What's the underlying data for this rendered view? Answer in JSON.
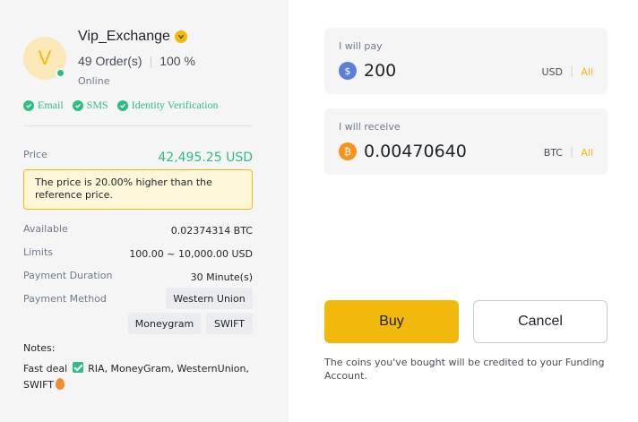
{
  "merchant": {
    "avatar_letter": "V",
    "name": "Vip_Exchange",
    "orders": "49 Order(s)",
    "completion": "100 %",
    "status": "Online",
    "verifications": [
      "Email",
      "SMS",
      "Identity Verification"
    ]
  },
  "ad": {
    "price_label": "Price",
    "price_value": "42,495.25 USD",
    "price_note": "The price is 20.00% higher than the reference price.",
    "available_label": "Available",
    "available_value": "0.02374314 BTC",
    "limits_label": "Limits",
    "limits_value": "100.00 ~ 10,000.00 USD",
    "duration_label": "Payment Duration",
    "duration_value": "30 Minute(s)",
    "method_label": "Payment Method",
    "methods": [
      "Western Union",
      "Moneygram",
      "SWIFT"
    ],
    "notes_label": "Notes:",
    "notes_before": "Fast deal",
    "notes_after": "RIA, MoneyGram, WesternUnion, SWIFT"
  },
  "trade": {
    "pay_label": "I will pay",
    "pay_amount": "200",
    "pay_currency": "USD",
    "receive_label": "I will receive",
    "receive_amount": "0.00470640",
    "receive_currency": "BTC",
    "all_label": "All",
    "unit_sep": "|",
    "buy_label": "Buy",
    "cancel_label": "Cancel",
    "footer_note": "The coins you've bought will be credited to your Funding Account."
  },
  "colors": {
    "accent": "#f0b90b",
    "success": "#2ebd85",
    "usd_coin": "#5b7fd8",
    "btc_coin": "#f7931a"
  },
  "icons": {
    "usd": "dollar-coin-icon",
    "btc": "bitcoin-icon",
    "verified": "verified-badge-icon",
    "check": "check-circle-icon"
  }
}
